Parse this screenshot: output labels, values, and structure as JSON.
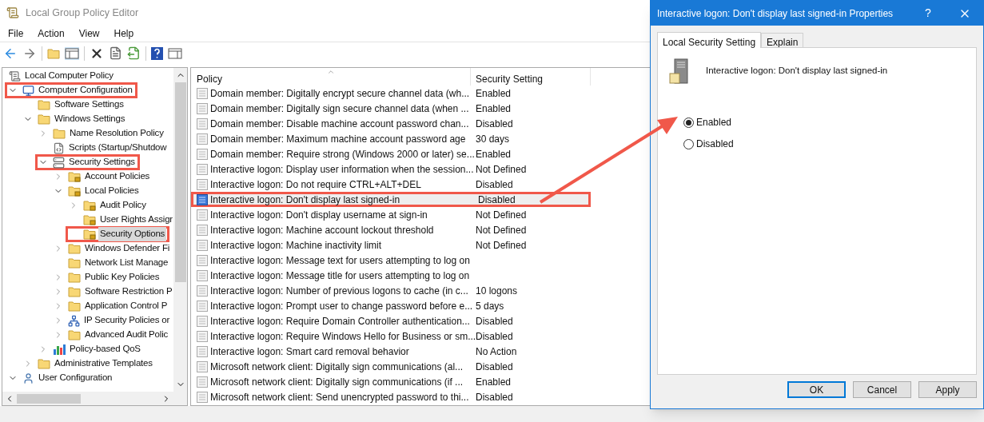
{
  "main_window": {
    "title": "Local Group Policy Editor",
    "menu": [
      "File",
      "Action",
      "View",
      "Help"
    ],
    "tree": [
      {
        "label": "Local Computer Policy",
        "kind": "policy",
        "expandable": false,
        "expanded": false,
        "selected": false,
        "annotated": false,
        "children": [
          {
            "label": "Computer Configuration",
            "kind": "computer",
            "expandable": true,
            "expanded": true,
            "selected": false,
            "annotated": true,
            "children": [
              {
                "label": "Software Settings",
                "kind": "folder",
                "expandable": false,
                "expanded": false,
                "selected": false,
                "annotated": false
              },
              {
                "label": "Windows Settings",
                "kind": "folder",
                "expandable": true,
                "expanded": true,
                "selected": false,
                "annotated": false,
                "children": [
                  {
                    "label": "Name Resolution Policy",
                    "kind": "folder",
                    "expandable": true,
                    "expanded": false,
                    "selected": false,
                    "annotated": false
                  },
                  {
                    "label": "Scripts (Startup/Shutdow",
                    "kind": "script",
                    "expandable": false,
                    "expanded": false,
                    "selected": false,
                    "annotated": false
                  },
                  {
                    "label": "Security Settings",
                    "kind": "server",
                    "expandable": true,
                    "expanded": true,
                    "selected": false,
                    "annotated": true,
                    "children": [
                      {
                        "label": "Account Policies",
                        "kind": "lock-folder",
                        "expandable": true,
                        "expanded": false,
                        "selected": false,
                        "annotated": false
                      },
                      {
                        "label": "Local Policies",
                        "kind": "lock-folder",
                        "expandable": true,
                        "expanded": true,
                        "selected": false,
                        "annotated": false,
                        "children": [
                          {
                            "label": "Audit Policy",
                            "kind": "lock-folder",
                            "expandable": true,
                            "expanded": false,
                            "selected": false,
                            "annotated": false
                          },
                          {
                            "label": "User Rights Assigr",
                            "kind": "lock-folder",
                            "expandable": false,
                            "expanded": false,
                            "selected": false,
                            "annotated": false
                          },
                          {
                            "label": "Security Options",
                            "kind": "lock-folder",
                            "expandable": false,
                            "expanded": false,
                            "selected": true,
                            "annotated": true
                          }
                        ]
                      },
                      {
                        "label": "Windows Defender Fi",
                        "kind": "folder",
                        "expandable": true,
                        "expanded": false,
                        "selected": false,
                        "annotated": false
                      },
                      {
                        "label": "Network List Manage",
                        "kind": "folder",
                        "expandable": false,
                        "expanded": false,
                        "selected": false,
                        "annotated": false
                      },
                      {
                        "label": "Public Key Policies",
                        "kind": "folder",
                        "expandable": true,
                        "expanded": false,
                        "selected": false,
                        "annotated": false
                      },
                      {
                        "label": "Software Restriction P",
                        "kind": "folder",
                        "expandable": true,
                        "expanded": false,
                        "selected": false,
                        "annotated": false
                      },
                      {
                        "label": "Application Control P",
                        "kind": "folder",
                        "expandable": true,
                        "expanded": false,
                        "selected": false,
                        "annotated": false
                      },
                      {
                        "label": "IP Security Policies or",
                        "kind": "network",
                        "expandable": true,
                        "expanded": false,
                        "selected": false,
                        "annotated": false
                      },
                      {
                        "label": "Advanced Audit Polic",
                        "kind": "folder",
                        "expandable": true,
                        "expanded": false,
                        "selected": false,
                        "annotated": false
                      }
                    ]
                  },
                  {
                    "label": "Policy-based QoS",
                    "kind": "chart",
                    "expandable": true,
                    "expanded": false,
                    "selected": false,
                    "annotated": false
                  }
                ]
              },
              {
                "label": "Administrative Templates",
                "kind": "folder",
                "expandable": true,
                "expanded": false,
                "selected": false,
                "annotated": false
              }
            ]
          },
          {
            "label": "User Configuration",
            "kind": "user",
            "expandable": true,
            "expanded": true,
            "selected": false,
            "annotated": false
          }
        ]
      }
    ],
    "list": {
      "columns": [
        "Policy",
        "Security Setting"
      ],
      "rows": [
        {
          "policy": "Domain member: Digitally encrypt secure channel data (wh...",
          "setting": "Enabled",
          "selected": false,
          "annotated": false
        },
        {
          "policy": "Domain member: Digitally sign secure channel data (when ...",
          "setting": "Enabled",
          "selected": false,
          "annotated": false
        },
        {
          "policy": "Domain member: Disable machine account password chan...",
          "setting": "Disabled",
          "selected": false,
          "annotated": false
        },
        {
          "policy": "Domain member: Maximum machine account password age",
          "setting": "30 days",
          "selected": false,
          "annotated": false
        },
        {
          "policy": "Domain member: Require strong (Windows 2000 or later) se...",
          "setting": "Enabled",
          "selected": false,
          "annotated": false
        },
        {
          "policy": "Interactive logon: Display user information when the session...",
          "setting": "Not Defined",
          "selected": false,
          "annotated": false
        },
        {
          "policy": "Interactive logon: Do not require CTRL+ALT+DEL",
          "setting": "Disabled",
          "selected": false,
          "annotated": false
        },
        {
          "policy": "Interactive logon: Don't display last signed-in",
          "setting": "Disabled",
          "selected": true,
          "annotated": true
        },
        {
          "policy": "Interactive logon: Don't display username at sign-in",
          "setting": "Not Defined",
          "selected": false,
          "annotated": false
        },
        {
          "policy": "Interactive logon: Machine account lockout threshold",
          "setting": "Not Defined",
          "selected": false,
          "annotated": false
        },
        {
          "policy": "Interactive logon: Machine inactivity limit",
          "setting": "Not Defined",
          "selected": false,
          "annotated": false
        },
        {
          "policy": "Interactive logon: Message text for users attempting to log on",
          "selected": false,
          "annotated": false
        },
        {
          "policy": "Interactive logon: Message title for users attempting to log on",
          "selected": false,
          "annotated": false
        },
        {
          "policy": "Interactive logon: Number of previous logons to cache (in c...",
          "setting": "10 logons",
          "selected": false,
          "annotated": false
        },
        {
          "policy": "Interactive logon: Prompt user to change password before e...",
          "setting": "5 days",
          "selected": false,
          "annotated": false
        },
        {
          "policy": "Interactive logon: Require Domain Controller authentication...",
          "setting": "Disabled",
          "selected": false,
          "annotated": false
        },
        {
          "policy": "Interactive logon: Require Windows Hello for Business or sm...",
          "setting": "Disabled",
          "selected": false,
          "annotated": false
        },
        {
          "policy": "Interactive logon: Smart card removal behavior",
          "setting": "No Action",
          "selected": false,
          "annotated": false
        },
        {
          "policy": "Microsoft network client: Digitally sign communications (al...",
          "setting": "Disabled",
          "selected": false,
          "annotated": false
        },
        {
          "policy": "Microsoft network client: Digitally sign communications (if ...",
          "setting": "Enabled",
          "selected": false,
          "annotated": false
        },
        {
          "policy": "Microsoft network client: Send unencrypted password to thi...",
          "setting": "Disabled",
          "selected": false,
          "annotated": false
        }
      ]
    }
  },
  "dialog": {
    "title": "Interactive logon: Don't display last signed-in Properties",
    "help": "?",
    "tabs": [
      {
        "label": "Local Security Setting",
        "selected": true
      },
      {
        "label": "Explain",
        "selected": false
      }
    ],
    "policy_name": "Interactive logon: Don't display last signed-in",
    "options": [
      {
        "label": "Enabled",
        "selected": true
      },
      {
        "label": "Disabled",
        "selected": false
      }
    ],
    "buttons": [
      {
        "label": "OK",
        "default": true
      },
      {
        "label": "Cancel",
        "default": false
      },
      {
        "label": "Apply",
        "default": false
      }
    ]
  }
}
